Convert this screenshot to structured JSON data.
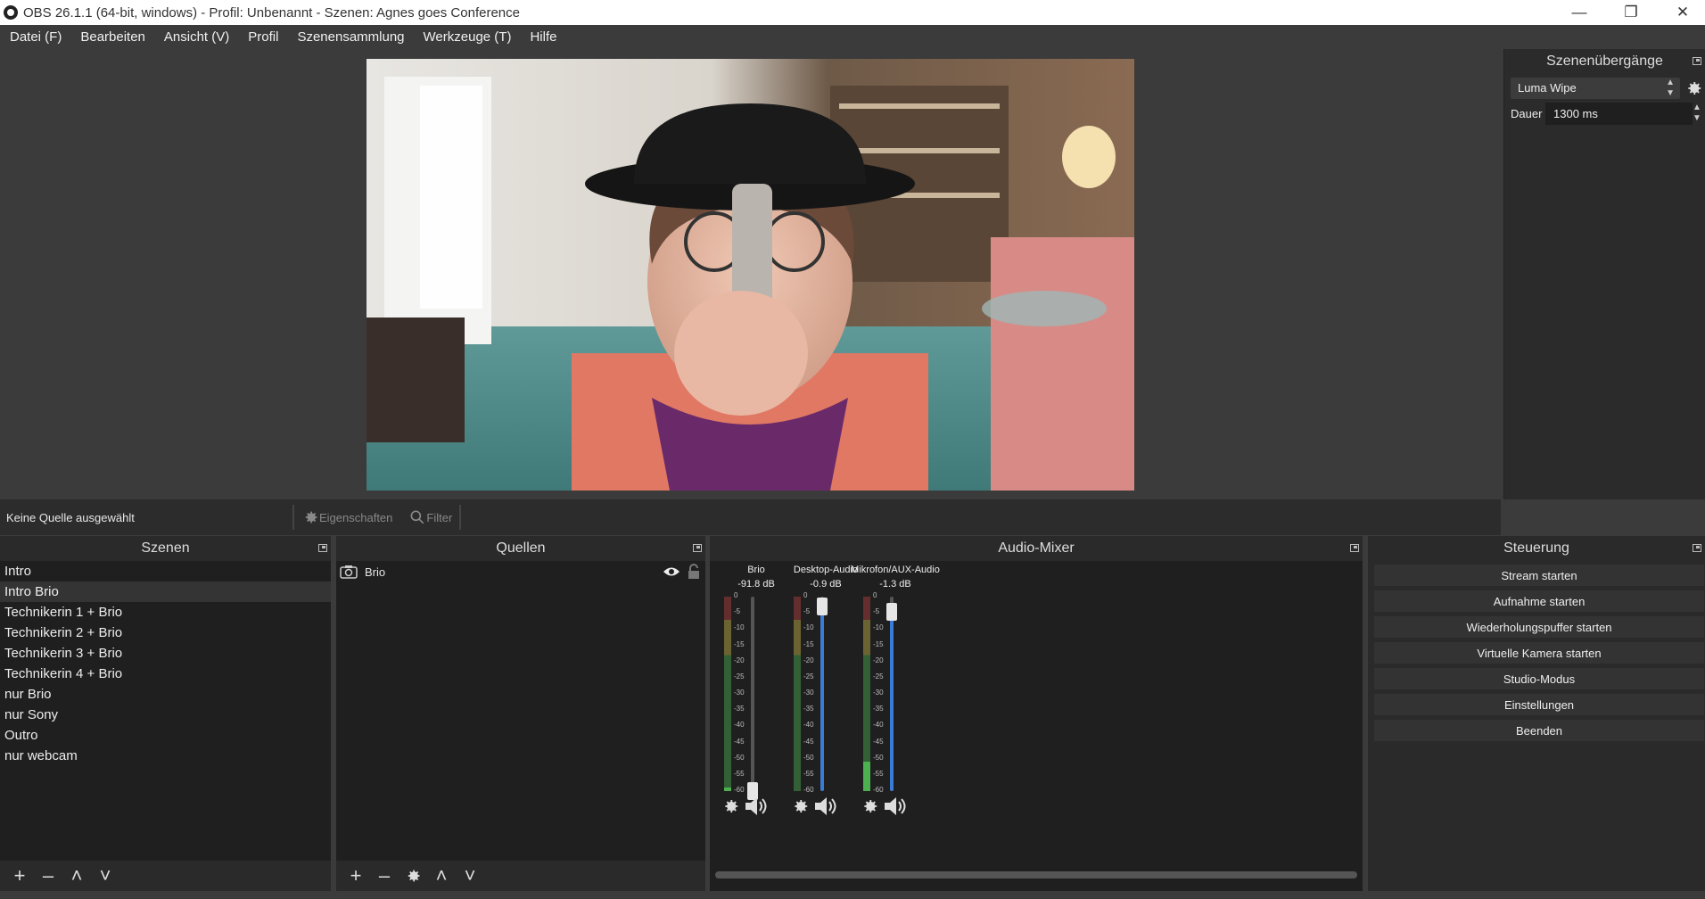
{
  "window": {
    "title": "OBS 26.1.1 (64-bit, windows) - Profil: Unbenannt - Szenen: Agnes goes Conference"
  },
  "menu": [
    "Datei (F)",
    "Bearbeiten",
    "Ansicht (V)",
    "Profil",
    "Szenensammlung",
    "Werkzeuge (T)",
    "Hilfe"
  ],
  "transitions": {
    "title": "Szenenübergänge",
    "selected": "Luma Wipe",
    "duration_label": "Dauer",
    "duration_value": "1300 ms"
  },
  "source_bar": {
    "status": "Keine Quelle ausgewählt",
    "properties": "Eigenschaften",
    "filter": "Filter"
  },
  "scenes": {
    "title": "Szenen",
    "items": [
      "Intro",
      "Intro Brio",
      "Technikerin 1 + Brio",
      "Technikerin 2 + Brio",
      "Technikerin 3 + Brio",
      "Technikerin 4 + Brio",
      "nur Brio",
      "nur Sony",
      "Outro",
      "nur webcam"
    ],
    "selected_index": 1
  },
  "sources": {
    "title": "Quellen",
    "items": [
      {
        "name": "Brio",
        "icon": "camera-icon"
      }
    ]
  },
  "mixer": {
    "title": "Audio-Mixer",
    "channels": [
      {
        "name": "Brio",
        "db": "-91.8 dB",
        "level": 0.02,
        "volume": 0.0
      },
      {
        "name": "Desktop-Audio",
        "db": "-0.9 dB",
        "level": 0.0,
        "volume": 0.95
      },
      {
        "name": "Mikrofon/AUX-Audio",
        "db": "-1.3 dB",
        "level": 0.15,
        "volume": 0.92
      }
    ],
    "scale": [
      "0",
      "-5",
      "-10",
      "-15",
      "-20",
      "-25",
      "-30",
      "-35",
      "-40",
      "-45",
      "-50",
      "-55",
      "-60"
    ]
  },
  "controls": {
    "title": "Steuerung",
    "buttons": [
      "Stream starten",
      "Aufnahme starten",
      "Wiederholungspuffer starten",
      "Virtuelle Kamera starten",
      "Studio-Modus",
      "Einstellungen",
      "Beenden"
    ]
  },
  "colors": {
    "meter_green": "#4caf50",
    "meter_yellow": "#c8b84a",
    "meter_red": "#b84040",
    "volume_blue": "#3a7bd5"
  }
}
